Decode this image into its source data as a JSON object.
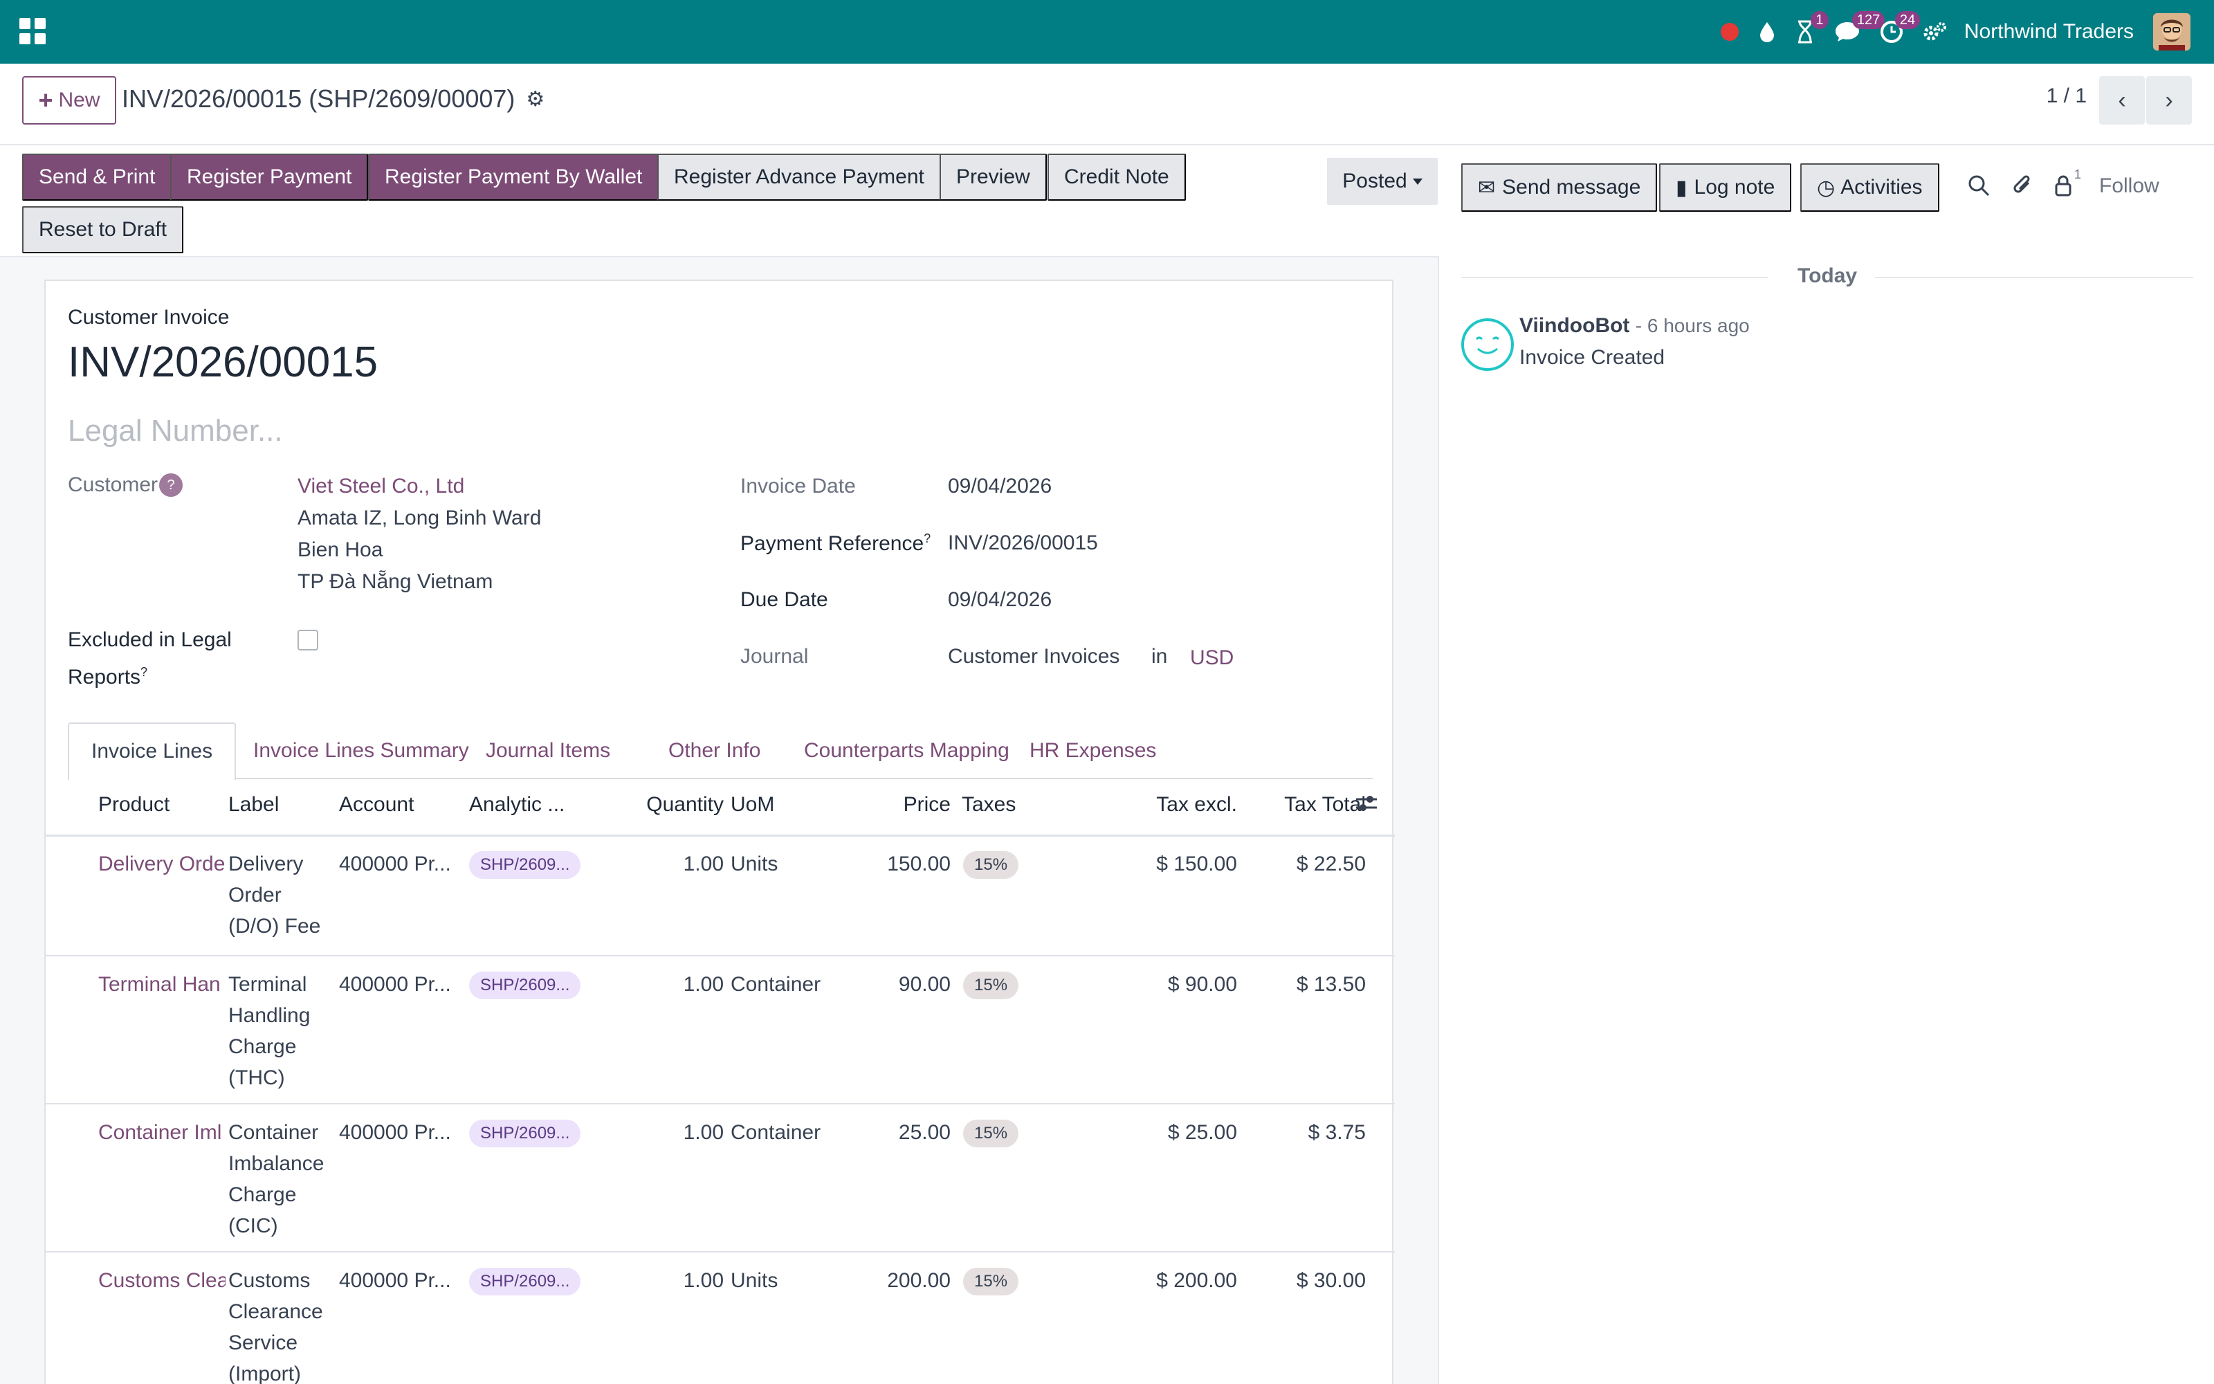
{
  "navbar": {
    "company": "Northwind Traders",
    "activity_badge": "1",
    "messages_badge": "127",
    "clock_badge": "24",
    "icons": [
      "apps-icon",
      "record-icon",
      "drop-icon",
      "hourglass-icon",
      "chat-icon",
      "clock-icon",
      "settings-icon"
    ]
  },
  "control": {
    "new_label": "New",
    "breadcrumb": "INV/2026/00015 (SHP/2609/00007)",
    "pager": "1 / 1"
  },
  "statusbar": {
    "send_print": "Send & Print",
    "register_payment": "Register Payment",
    "register_wallet": "Register Payment By Wallet",
    "register_advance": "Register Advance Payment",
    "preview": "Preview",
    "credit_note": "Credit Note",
    "reset_draft": "Reset to Draft",
    "state": "Posted"
  },
  "form": {
    "doc_type": "Customer Invoice",
    "number": "INV/2026/00015",
    "legal_placeholder": "Legal Number...",
    "customer_label": "Customer",
    "customer_help": "?",
    "customer_name": "Viet Steel Co., Ltd",
    "address_line1": "Amata IZ, Long Binh Ward",
    "address_line2": "Bien Hoa",
    "address_line3": "TP Đà Nẵng Vietnam",
    "excluded_label_1": "Excluded in Legal",
    "excluded_label_2": "Reports",
    "invoice_date_label": "Invoice Date",
    "invoice_date": "09/04/2026",
    "payment_ref_label": "Payment Reference",
    "payment_ref": "INV/2026/00015",
    "due_date_label": "Due Date",
    "due_date": "09/04/2026",
    "journal_label": "Journal",
    "journal": "Customer Invoices",
    "journal_in": "in",
    "currency": "USD"
  },
  "tabs": [
    "Invoice Lines",
    "Invoice Lines Summary",
    "Journal Items",
    "Other Info",
    "Counterparts Mapping",
    "HR Expenses"
  ],
  "table": {
    "headers": {
      "product": "Product",
      "label": "Label",
      "account": "Account",
      "analytic": "Analytic ...",
      "quantity": "Quantity",
      "uom": "UoM",
      "price": "Price",
      "taxes": "Taxes",
      "tax_excl": "Tax excl.",
      "tax_total": "Tax Total"
    },
    "rows": [
      {
        "product": "Delivery Orde",
        "label": [
          "Delivery",
          "Order",
          "(D/O) Fee"
        ],
        "account": "400000 Pr...",
        "analytic": "SHP/2609...",
        "quantity": "1.00",
        "uom": "Units",
        "price": "150.00",
        "tax": "15%",
        "tax_excl": "$ 150.00",
        "tax_total": "$ 22.50"
      },
      {
        "product": "Terminal Han",
        "label": [
          "Terminal",
          "Handling",
          "Charge",
          "(THC)"
        ],
        "account": "400000 Pr...",
        "analytic": "SHP/2609...",
        "quantity": "1.00",
        "uom": "Container",
        "price": "90.00",
        "tax": "15%",
        "tax_excl": "$ 90.00",
        "tax_total": "$ 13.50"
      },
      {
        "product": "Container Iml",
        "label": [
          "Container",
          "Imbalance",
          "Charge",
          "(CIC)"
        ],
        "account": "400000 Pr...",
        "analytic": "SHP/2609...",
        "quantity": "1.00",
        "uom": "Container",
        "price": "25.00",
        "tax": "15%",
        "tax_excl": "$ 25.00",
        "tax_total": "$ 3.75"
      },
      {
        "product": "Customs Clea",
        "label": [
          "Customs",
          "Clearance",
          "Service",
          "(Import)"
        ],
        "account": "400000 Pr...",
        "analytic": "SHP/2609...",
        "quantity": "1.00",
        "uom": "Units",
        "price": "200.00",
        "tax": "15%",
        "tax_excl": "$ 200.00",
        "tax_total": "$ 30.00"
      }
    ]
  },
  "chatter": {
    "send_message": "Send message",
    "log_note": "Log note",
    "activities": "Activities",
    "followers_count": "1",
    "follow": "Follow",
    "today": "Today",
    "author": "ViindooBot",
    "time": "- 6 hours ago",
    "body": "Invoice Created"
  },
  "colors": {
    "navbar": "#017e84",
    "primary": "#7c4c77"
  }
}
